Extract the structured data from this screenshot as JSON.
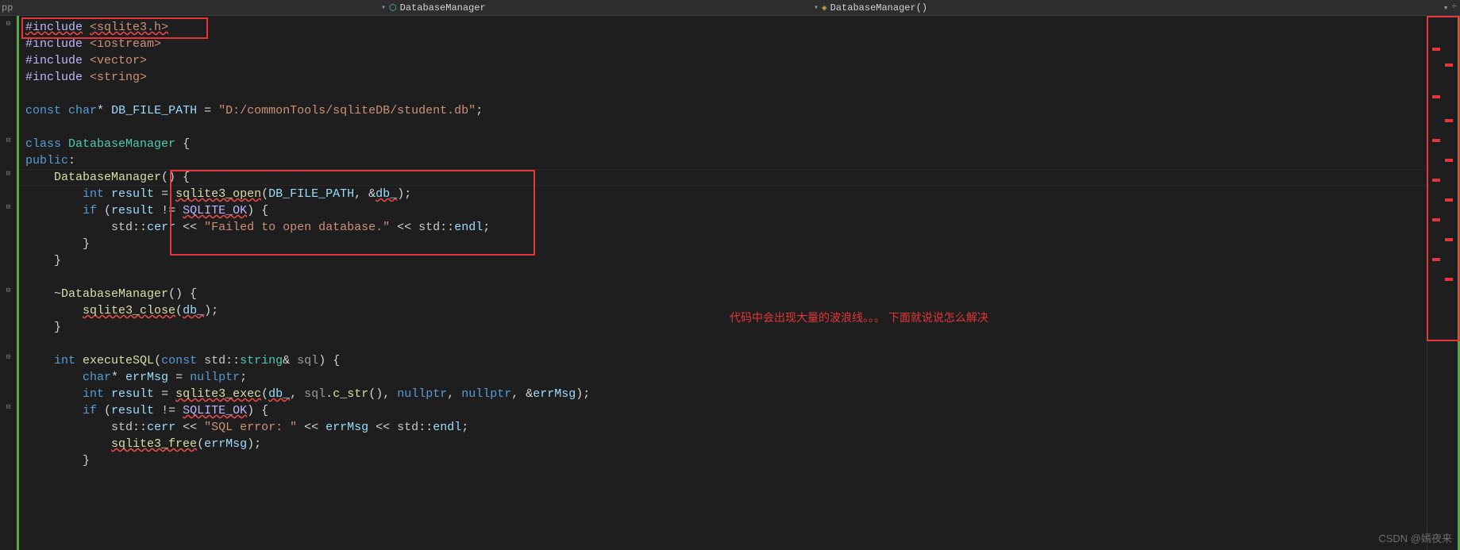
{
  "topbar": {
    "left_label": "pp",
    "breadcrumb1": "DatabaseManager",
    "breadcrumb2": "DatabaseManager()",
    "nav_prev": "▾",
    "nav_sep": "▾",
    "right1": "▾",
    "right2": "÷"
  },
  "code": {
    "l1_a": "#include",
    "l1_b": "<sqlite3.h>",
    "l2_a": "#include",
    "l2_b": "<iostream>",
    "l3_a": "#include",
    "l3_b": "<vector>",
    "l4_a": "#include",
    "l4_b": "<string>",
    "l6_a": "const",
    "l6_b": "char",
    "l6_c": "*",
    "l6_d": "DB_FILE_PATH",
    "l6_e": " = ",
    "l6_f": "\"D:/commonTools/sqliteDB/student.db\"",
    "l6_g": ";",
    "l8_a": "class",
    "l8_b": "DatabaseManager",
    "l8_c": " {",
    "l9_a": "public",
    "l9_b": ":",
    "l10_a": "    ",
    "l10_b": "DatabaseManager",
    "l10_c": "() {",
    "l11_a": "        ",
    "l11_b": "int",
    "l11_c": " ",
    "l11_d": "result",
    "l11_e": " = ",
    "l11_f": "sqlite3_open",
    "l11_g": "(",
    "l11_h": "DB_FILE_PATH",
    "l11_i": ", &",
    "l11_j": "db_",
    "l11_k": ");",
    "l12_a": "        ",
    "l12_b": "if",
    "l12_c": " (",
    "l12_d": "result",
    "l12_e": " != ",
    "l12_f": "SQLITE_OK",
    "l12_g": ") {",
    "l13_a": "            ",
    "l13_b": "std",
    "l13_c": "::",
    "l13_d": "cerr",
    "l13_e": " << ",
    "l13_f": "\"Failed to open database.\"",
    "l13_g": " << ",
    "l13_h": "std",
    "l13_i": "::",
    "l13_j": "endl",
    "l13_k": ";",
    "l14_a": "        }",
    "l15_a": "    }",
    "l17_a": "    ~",
    "l17_b": "DatabaseManager",
    "l17_c": "() {",
    "l18_a": "        ",
    "l18_b": "sqlite3_close",
    "l18_c": "(",
    "l18_d": "db_",
    "l18_e": ");",
    "l19_a": "    }",
    "l21_a": "    ",
    "l21_b": "int",
    "l21_c": " ",
    "l21_d": "executeSQL",
    "l21_e": "(",
    "l21_f": "const",
    "l21_g": " ",
    "l21_h": "std",
    "l21_i": "::",
    "l21_j": "string",
    "l21_k": "& ",
    "l21_l": "sql",
    "l21_m": ") {",
    "l22_a": "        ",
    "l22_b": "char",
    "l22_c": "* ",
    "l22_d": "errMsg",
    "l22_e": " = ",
    "l22_f": "nullptr",
    "l22_g": ";",
    "l23_a": "        ",
    "l23_b": "int",
    "l23_c": " ",
    "l23_d": "result",
    "l23_e": " = ",
    "l23_f": "sqlite3_exec",
    "l23_g": "(",
    "l23_h": "db_",
    "l23_i": ", ",
    "l23_j": "sql",
    "l23_k": ".",
    "l23_l": "c_str",
    "l23_m": "(), ",
    "l23_n": "nullptr",
    "l23_o": ", ",
    "l23_p": "nullptr",
    "l23_q": ", &",
    "l23_r": "errMsg",
    "l23_s": ");",
    "l24_a": "        ",
    "l24_b": "if",
    "l24_c": " (",
    "l24_d": "result",
    "l24_e": " != ",
    "l24_f": "SQLITE_OK",
    "l24_g": ") {",
    "l25_a": "            ",
    "l25_b": "std",
    "l25_c": "::",
    "l25_d": "cerr",
    "l25_e": " << ",
    "l25_f": "\"SQL error: \"",
    "l25_g": " << ",
    "l25_h": "errMsg",
    "l25_i": " << ",
    "l25_j": "std",
    "l25_k": "::",
    "l25_l": "endl",
    "l25_m": ";",
    "l26_a": "            ",
    "l26_b": "sqlite3_free",
    "l26_c": "(",
    "l26_d": "errMsg",
    "l26_e": ");",
    "l27_a": "        }"
  },
  "gutter": {
    "collapse": "⊟",
    "expand": "⊟"
  },
  "annotation": "代码中会出现大量的波浪线。。。 下面就说说怎么解决",
  "scrollmarks": [
    40,
    60,
    100,
    130,
    155,
    180,
    205,
    230,
    255,
    280,
    305,
    330
  ],
  "watermark": "CSDN @嫣夜来"
}
